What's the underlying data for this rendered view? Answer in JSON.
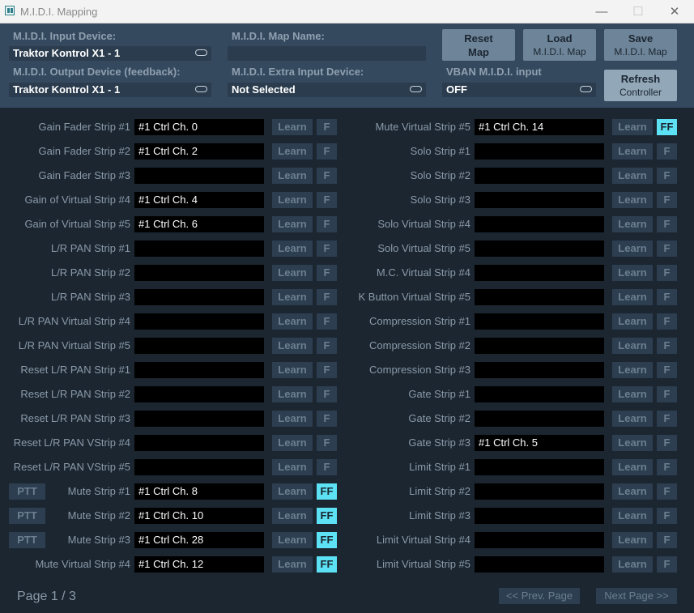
{
  "window": {
    "title": "M.I.D.I. Mapping",
    "minimize_glyph": "—",
    "maximize_glyph": "☐",
    "close_glyph": "✕"
  },
  "top": {
    "input_device_label": "M.I.D.I. Input Device:",
    "input_device_value": "Traktor Kontrol X1 - 1",
    "output_device_label": "M.I.D.I. Output Device (feedback):",
    "output_device_value": "Traktor Kontrol X1 - 1",
    "map_name_label": "M.I.D.I. Map Name:",
    "map_name_value": "",
    "extra_input_label": "M.I.D.I. Extra Input Device:",
    "extra_input_value": "Not Selected",
    "vban_label": "VBAN M.I.D.I. input",
    "vban_value": "OFF",
    "reset_btn": {
      "line1": "Reset",
      "line2": "Map"
    },
    "load_btn": {
      "line1": "Load",
      "line2": "M.I.D.I. Map"
    },
    "save_btn": {
      "line1": "Save",
      "line2": "M.I.D.I. Map"
    },
    "refresh_btn": {
      "line1": "Refresh",
      "line2": "Controller"
    }
  },
  "labels": {
    "learn": "Learn",
    "f": "F",
    "ff": "FF",
    "ptt": "PTT"
  },
  "left_rows": [
    {
      "label": "Gain Fader Strip #1",
      "value": "#1 Ctrl Ch. 0",
      "ff": false,
      "ptt": false
    },
    {
      "label": "Gain Fader Strip #2",
      "value": "#1 Ctrl Ch. 2",
      "ff": false,
      "ptt": false
    },
    {
      "label": "Gain Fader Strip #3",
      "value": "",
      "ff": false,
      "ptt": false
    },
    {
      "label": "Gain of Virtual Strip #4",
      "value": "#1 Ctrl Ch. 4",
      "ff": false,
      "ptt": false
    },
    {
      "label": "Gain of Virtual Strip #5",
      "value": "#1 Ctrl Ch. 6",
      "ff": false,
      "ptt": false
    },
    {
      "label": "L/R PAN Strip #1",
      "value": "",
      "ff": false,
      "ptt": false
    },
    {
      "label": "L/R PAN Strip #2",
      "value": "",
      "ff": false,
      "ptt": false
    },
    {
      "label": "L/R PAN Strip #3",
      "value": "",
      "ff": false,
      "ptt": false
    },
    {
      "label": "L/R PAN Virtual Strip #4",
      "value": "",
      "ff": false,
      "ptt": false
    },
    {
      "label": "L/R PAN Virtual Strip #5",
      "value": "",
      "ff": false,
      "ptt": false
    },
    {
      "label": "Reset L/R PAN Strip #1",
      "value": "",
      "ff": false,
      "ptt": false
    },
    {
      "label": "Reset L/R PAN Strip #2",
      "value": "",
      "ff": false,
      "ptt": false
    },
    {
      "label": "Reset L/R PAN Strip #3",
      "value": "",
      "ff": false,
      "ptt": false
    },
    {
      "label": "Reset L/R PAN VStrip #4",
      "value": "",
      "ff": false,
      "ptt": false
    },
    {
      "label": "Reset L/R PAN VStrip #5",
      "value": "",
      "ff": false,
      "ptt": false
    },
    {
      "label": "Mute Strip #1",
      "value": "#1 Ctrl Ch. 8",
      "ff": true,
      "ptt": true
    },
    {
      "label": "Mute Strip #2",
      "value": "#1 Ctrl Ch. 10",
      "ff": true,
      "ptt": true
    },
    {
      "label": "Mute Strip #3",
      "value": "#1 Ctrl Ch. 28",
      "ff": true,
      "ptt": true
    },
    {
      "label": "Mute Virtual Strip #4",
      "value": "#1 Ctrl Ch. 12",
      "ff": true,
      "ptt": false
    }
  ],
  "right_rows": [
    {
      "label": "Mute Virtual Strip #5",
      "value": "#1 Ctrl Ch. 14",
      "ff": true
    },
    {
      "label": "Solo Strip #1",
      "value": "",
      "ff": false
    },
    {
      "label": "Solo Strip #2",
      "value": "",
      "ff": false
    },
    {
      "label": "Solo Strip #3",
      "value": "",
      "ff": false
    },
    {
      "label": "Solo Virtual Strip #4",
      "value": "",
      "ff": false
    },
    {
      "label": "Solo Virtual Strip #5",
      "value": "",
      "ff": false
    },
    {
      "label": "M.C. Virtual Strip #4",
      "value": "",
      "ff": false
    },
    {
      "label": "K Button Virtual Strip #5",
      "value": "",
      "ff": false
    },
    {
      "label": "Compression Strip #1",
      "value": "",
      "ff": false
    },
    {
      "label": "Compression Strip #2",
      "value": "",
      "ff": false
    },
    {
      "label": "Compression Strip #3",
      "value": "",
      "ff": false
    },
    {
      "label": "Gate Strip #1",
      "value": "",
      "ff": false
    },
    {
      "label": "Gate Strip #2",
      "value": "",
      "ff": false
    },
    {
      "label": "Gate Strip #3",
      "value": "#1 Ctrl Ch. 5",
      "ff": false
    },
    {
      "label": "Limit Strip #1",
      "value": "",
      "ff": false
    },
    {
      "label": "Limit Strip #2",
      "value": "",
      "ff": false
    },
    {
      "label": "Limit Strip #3",
      "value": "",
      "ff": false
    },
    {
      "label": "Limit Virtual Strip #4",
      "value": "",
      "ff": false
    },
    {
      "label": "Limit Virtual Strip #5",
      "value": "",
      "ff": false
    }
  ],
  "footer": {
    "page": "Page 1 / 3",
    "prev": "<< Prev. Page",
    "next": "Next Page >>"
  },
  "colors": {
    "background": "#1b2631",
    "header_panel": "#34495e",
    "ff_active": "#5ce2f4",
    "button_idle": "#2c3e50"
  }
}
